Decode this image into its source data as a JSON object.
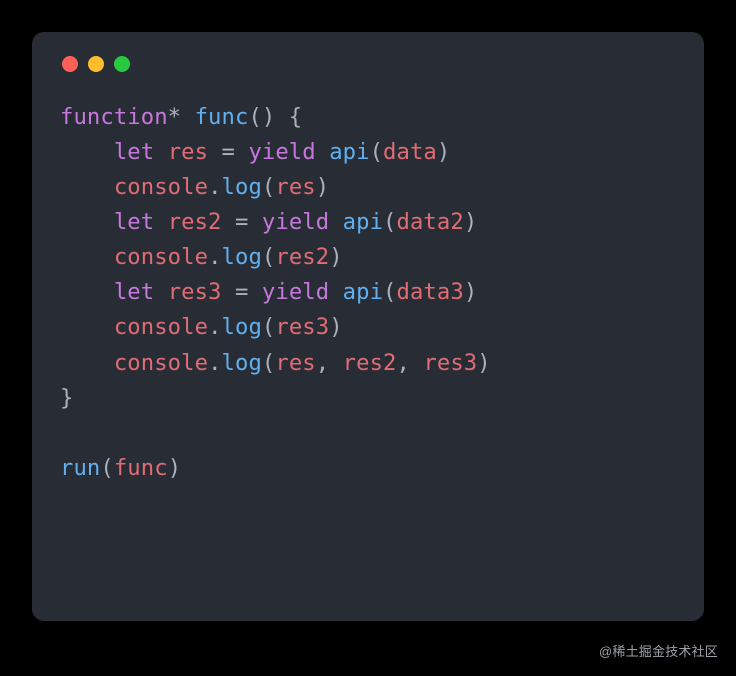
{
  "colors": {
    "background": "#000000",
    "window_bg": "#282c34",
    "red": "#ff5f56",
    "yellow": "#ffbd2e",
    "green": "#27c93f",
    "keyword": "#c678dd",
    "function": "#61afef",
    "variable": "#e06c75",
    "punctuation": "#abb2bf"
  },
  "code": {
    "lines": [
      [
        {
          "t": "function",
          "c": "kw"
        },
        {
          "t": "* ",
          "c": "pn"
        },
        {
          "t": "func",
          "c": "fn"
        },
        {
          "t": "() {",
          "c": "pn"
        }
      ],
      [
        {
          "t": "    ",
          "c": "pn"
        },
        {
          "t": "let",
          "c": "kw"
        },
        {
          "t": " ",
          "c": "pn"
        },
        {
          "t": "res",
          "c": "var"
        },
        {
          "t": " = ",
          "c": "pn"
        },
        {
          "t": "yield",
          "c": "kw"
        },
        {
          "t": " ",
          "c": "pn"
        },
        {
          "t": "api",
          "c": "fn"
        },
        {
          "t": "(",
          "c": "pn"
        },
        {
          "t": "data",
          "c": "var"
        },
        {
          "t": ")",
          "c": "pn"
        }
      ],
      [
        {
          "t": "    ",
          "c": "pn"
        },
        {
          "t": "console",
          "c": "var"
        },
        {
          "t": ".",
          "c": "pn"
        },
        {
          "t": "log",
          "c": "fn"
        },
        {
          "t": "(",
          "c": "pn"
        },
        {
          "t": "res",
          "c": "var"
        },
        {
          "t": ")",
          "c": "pn"
        }
      ],
      [
        {
          "t": "    ",
          "c": "pn"
        },
        {
          "t": "let",
          "c": "kw"
        },
        {
          "t": " ",
          "c": "pn"
        },
        {
          "t": "res2",
          "c": "var"
        },
        {
          "t": " = ",
          "c": "pn"
        },
        {
          "t": "yield",
          "c": "kw"
        },
        {
          "t": " ",
          "c": "pn"
        },
        {
          "t": "api",
          "c": "fn"
        },
        {
          "t": "(",
          "c": "pn"
        },
        {
          "t": "data2",
          "c": "var"
        },
        {
          "t": ")",
          "c": "pn"
        }
      ],
      [
        {
          "t": "    ",
          "c": "pn"
        },
        {
          "t": "console",
          "c": "var"
        },
        {
          "t": ".",
          "c": "pn"
        },
        {
          "t": "log",
          "c": "fn"
        },
        {
          "t": "(",
          "c": "pn"
        },
        {
          "t": "res2",
          "c": "var"
        },
        {
          "t": ")",
          "c": "pn"
        }
      ],
      [
        {
          "t": "    ",
          "c": "pn"
        },
        {
          "t": "let",
          "c": "kw"
        },
        {
          "t": " ",
          "c": "pn"
        },
        {
          "t": "res3",
          "c": "var"
        },
        {
          "t": " = ",
          "c": "pn"
        },
        {
          "t": "yield",
          "c": "kw"
        },
        {
          "t": " ",
          "c": "pn"
        },
        {
          "t": "api",
          "c": "fn"
        },
        {
          "t": "(",
          "c": "pn"
        },
        {
          "t": "data3",
          "c": "var"
        },
        {
          "t": ")",
          "c": "pn"
        }
      ],
      [
        {
          "t": "    ",
          "c": "pn"
        },
        {
          "t": "console",
          "c": "var"
        },
        {
          "t": ".",
          "c": "pn"
        },
        {
          "t": "log",
          "c": "fn"
        },
        {
          "t": "(",
          "c": "pn"
        },
        {
          "t": "res3",
          "c": "var"
        },
        {
          "t": ")",
          "c": "pn"
        }
      ],
      [
        {
          "t": "    ",
          "c": "pn"
        },
        {
          "t": "console",
          "c": "var"
        },
        {
          "t": ".",
          "c": "pn"
        },
        {
          "t": "log",
          "c": "fn"
        },
        {
          "t": "(",
          "c": "pn"
        },
        {
          "t": "res",
          "c": "var"
        },
        {
          "t": ", ",
          "c": "pn"
        },
        {
          "t": "res2",
          "c": "var"
        },
        {
          "t": ", ",
          "c": "pn"
        },
        {
          "t": "res3",
          "c": "var"
        },
        {
          "t": ")",
          "c": "pn"
        }
      ],
      [
        {
          "t": "}",
          "c": "pn"
        }
      ],
      [
        {
          "t": "",
          "c": "pn"
        }
      ],
      [
        {
          "t": "run",
          "c": "fn"
        },
        {
          "t": "(",
          "c": "pn"
        },
        {
          "t": "func",
          "c": "var"
        },
        {
          "t": ")",
          "c": "pn"
        }
      ]
    ]
  },
  "watermark": "@稀土掘金技术社区"
}
